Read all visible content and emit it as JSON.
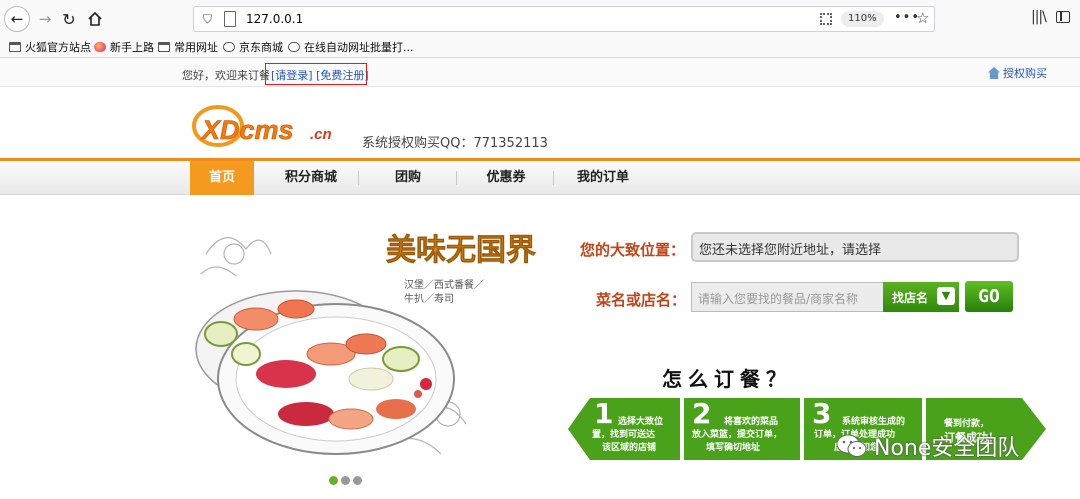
{
  "browser": {
    "url": "127.0.0.1",
    "zoom": "110%",
    "bookmarks": [
      "火狐官方站点",
      "新手上路",
      "常用网址",
      "京东商城",
      "在线自动网址批量打..."
    ]
  },
  "topbar": {
    "welcome": "您好，欢迎来订餐",
    "login": "[请登录]",
    "register": "[免费注册]",
    "buy_auth": "授权购买"
  },
  "header": {
    "logo_text": "XDcms",
    "logo_suffix": ".cn",
    "qq_text": "系统授权购买QQ：771352113"
  },
  "nav": {
    "items": [
      "首页",
      "积分商城",
      "团购",
      "优惠券",
      "我的订单"
    ],
    "active": 0
  },
  "banner": {
    "headline": "美味无国界",
    "sub1": "汉堡／西式番餐／",
    "sub2": "牛扒／寿司",
    "slides": 3,
    "active_slide": 0
  },
  "search": {
    "location_label": "您的大致位置：",
    "location_value": "您还未选择您附近地址，请选择",
    "name_label": "菜名或店名：",
    "name_placeholder": "请输入您要找的餐品/商家名称",
    "shop_button": "找店名",
    "go_button": "GO"
  },
  "howto": {
    "title": "怎么订餐？",
    "steps": [
      {
        "num": "1",
        "text1": "选择大致位",
        "text2": "置，找到可送达",
        "text3": "该区域的店铺"
      },
      {
        "num": "2",
        "text1": "将喜欢的菜品",
        "text2": "放入菜篮，提交订单，",
        "text3": "填写确切地址"
      },
      {
        "num": "3",
        "text1": "系统审核生成的",
        "text2": "订单，订单处理成功",
        "text3": "后，通知您"
      },
      {
        "num": "",
        "text1": "餐到付款，",
        "text2": "订餐成功！",
        "text3": ""
      }
    ]
  },
  "watermark": "None安全团队",
  "colors": {
    "accent": "#f49a1e",
    "green": "#4aa21a",
    "label": "#c0461a",
    "link": "#2255bb",
    "highlight_box": "#e02020"
  }
}
